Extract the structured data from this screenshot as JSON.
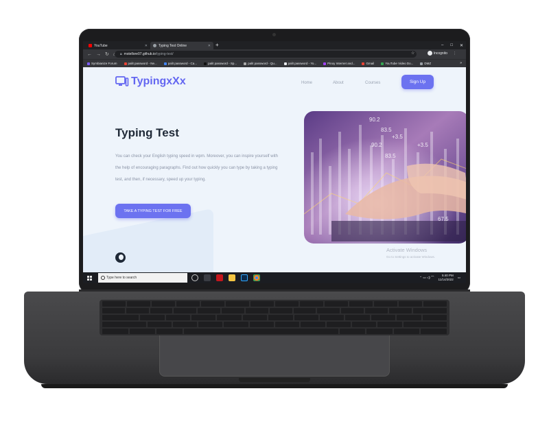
{
  "browser": {
    "tabs": [
      {
        "title": "YouTube",
        "favicon_color": "#ff0000"
      },
      {
        "title": "Typing Test Online",
        "favicon_color": "#9aa0a6"
      }
    ],
    "new_tab": "+",
    "window_controls": [
      "–",
      "□",
      "✕"
    ],
    "url_host": "mstellore07.github.io",
    "url_path": "/typing-test/",
    "mode": "Incognito",
    "bookmarks": [
      "Symbianize Forum",
      "palit password - Ne...",
      "palit password - Ca...",
      "palit password - Sp...",
      "palit password - Qu...",
      "palit password - Yo...",
      "Pinoy Internet and...",
      "Gmail",
      "YouTube Video Do...",
      "DMZ"
    ],
    "bookmarks_more": "»"
  },
  "page": {
    "logo_text": "TypingxXx",
    "nav": [
      "Home",
      "About",
      "Courses"
    ],
    "signup": "Sign Up",
    "title": "Typing Test",
    "description": "You can check your English typing speed in wpm. Moreover, you can inspire yourself with the help of encouraging paragraphs. Find out how quickly you can type by taking a typing test, and then, if necessary, speed up your typing.",
    "cta": "TAKE A TYPING TEST FOR FREE",
    "image_numbers": [
      "90.2",
      "83.5",
      "+3.5",
      "90.2",
      "83.5",
      "+3.5",
      "67.5"
    ],
    "activate_title": "Activate Windows",
    "activate_sub": "Go to Settings to activate Windows."
  },
  "taskbar": {
    "search_placeholder": "Type here to search",
    "time": "5:40 PM",
    "date": "11/14/2022"
  },
  "colors": {
    "accent": "#6c72f0",
    "page_bg": "#eef4fb"
  }
}
